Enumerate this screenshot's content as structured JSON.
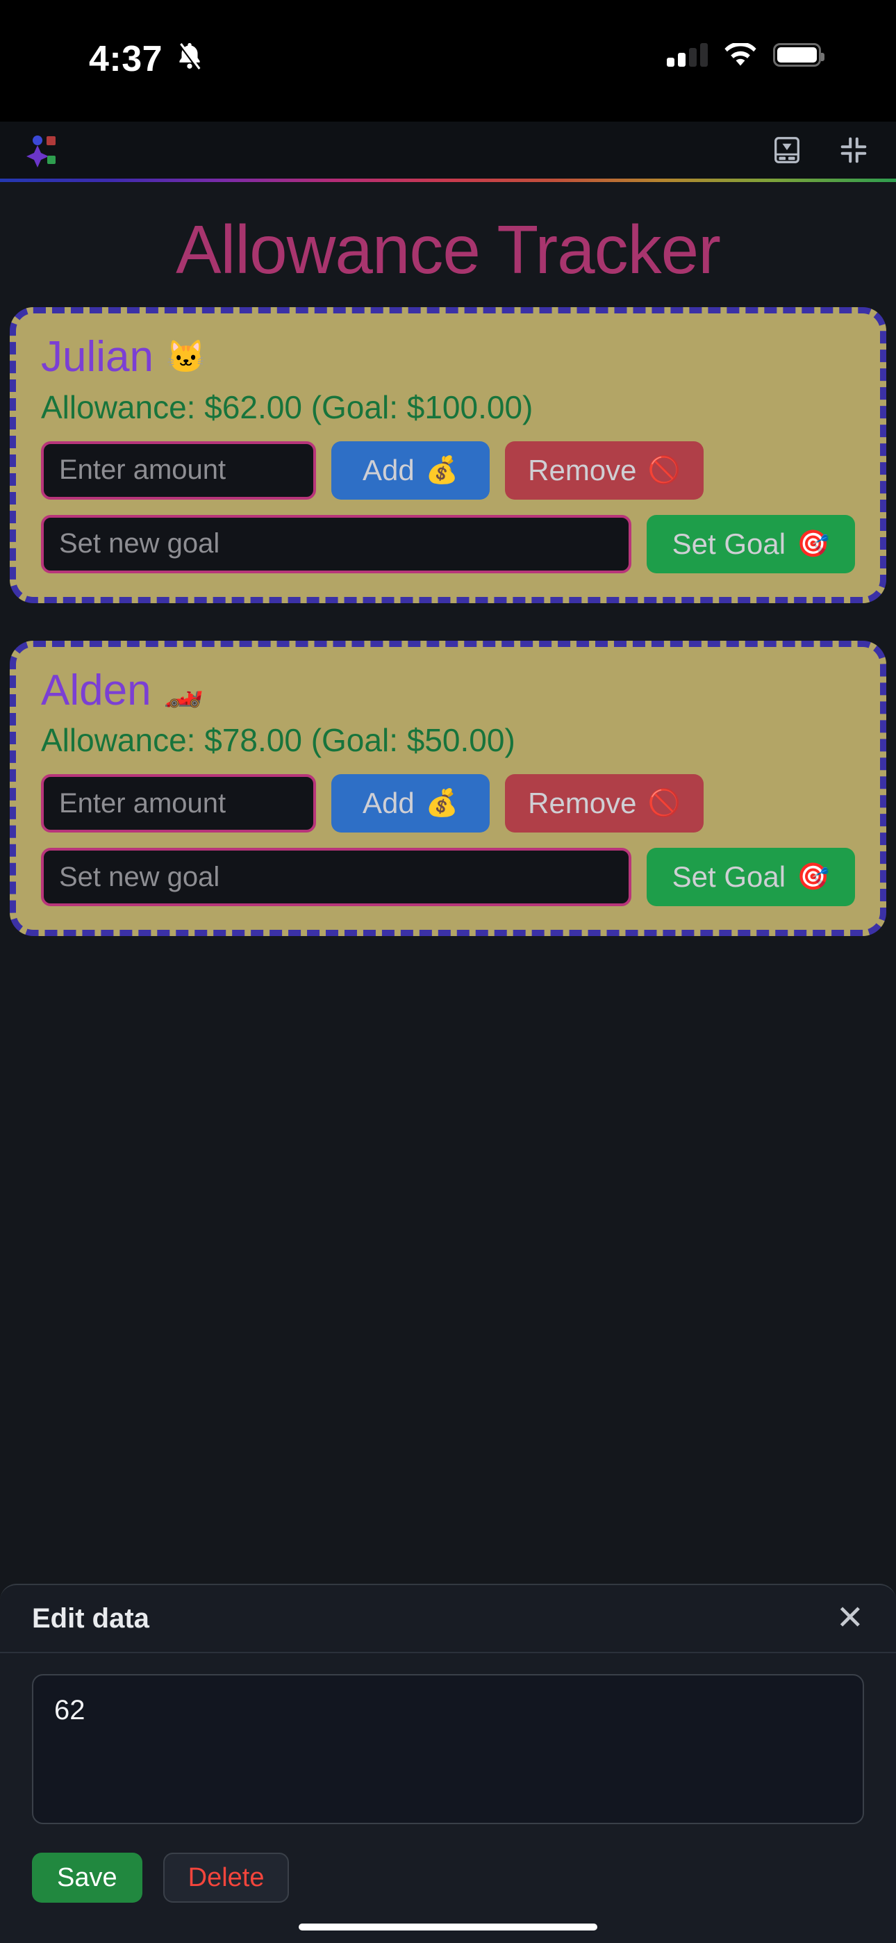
{
  "status_bar": {
    "time": "4:37",
    "bell_icon": "bell-muted-icon",
    "signal_icon": "cellular-signal-icon",
    "signal_bars_filled": 2,
    "signal_bars_total": 4,
    "wifi_icon": "wifi-icon",
    "battery_icon": "battery-full-icon",
    "battery_level_percent": 100
  },
  "chrome": {
    "brand_icon": "ai-sparkle-logo",
    "dock_panel_icon": "dock-to-bottom-icon",
    "collapse_icon": "collapse-inward-icon"
  },
  "app": {
    "title": "Allowance Tracker",
    "title_color": "#A8356E",
    "card_bg": "#B3A566",
    "card_border_color": "#3B31A6",
    "name_color": "#7B3FD4",
    "allowance_color": "#17743C",
    "input_border_color": "#B8357A"
  },
  "cards": [
    {
      "name": "Julian",
      "emoji": "🐱",
      "emoji_name": "cat-face-emoji",
      "allowance_line": "Allowance: $62.00 (Goal: $100.00)",
      "allowance": "$62.00",
      "goal": "$100.00",
      "amount_placeholder": "Enter amount",
      "amount_value": "",
      "goal_placeholder": "Set new goal",
      "goal_value": "",
      "add_label": "Add",
      "add_emoji": "💰",
      "remove_label": "Remove",
      "remove_emoji": "🚫",
      "set_goal_label": "Set Goal",
      "set_goal_emoji": "🎯"
    },
    {
      "name": "Alden",
      "emoji": "🏎️",
      "emoji_name": "racing-car-emoji",
      "allowance_line": "Allowance: $78.00 (Goal: $50.00)",
      "allowance": "$78.00",
      "goal": "$50.00",
      "amount_placeholder": "Enter amount",
      "amount_value": "",
      "goal_placeholder": "Set new goal",
      "goal_value": "",
      "add_label": "Add",
      "add_emoji": "💰",
      "remove_label": "Remove",
      "remove_emoji": "🚫",
      "set_goal_label": "Set Goal",
      "set_goal_emoji": "🎯"
    }
  ],
  "edit_panel": {
    "title": "Edit data",
    "close_label": "✕",
    "close_icon": "close-icon",
    "editor_value": "62",
    "editor_placeholder": "",
    "save_label": "Save",
    "delete_label": "Delete",
    "save_color": "#21883F",
    "delete_color": "#F4453C"
  }
}
